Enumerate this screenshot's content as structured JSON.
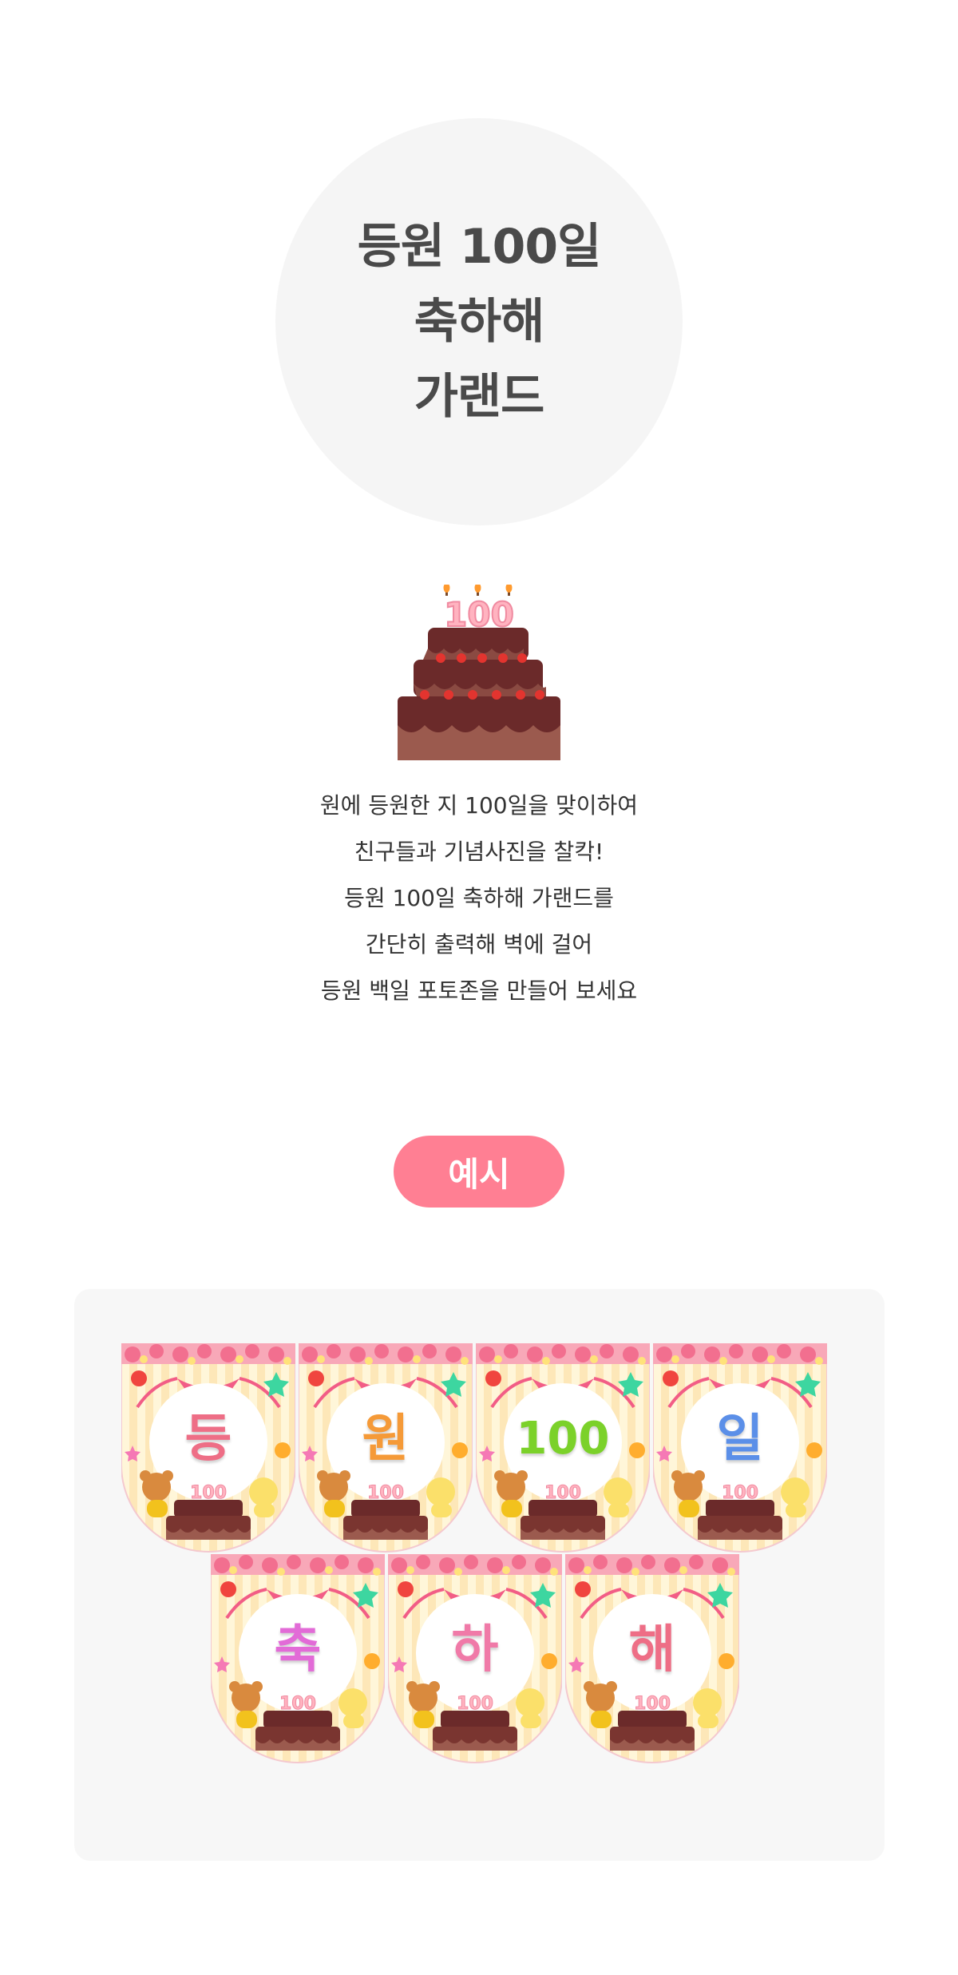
{
  "title": {
    "lines": [
      "등원 100일",
      "축하해",
      "가랜드"
    ]
  },
  "cake": {
    "topper_text": "100"
  },
  "description": {
    "lines": [
      "원에 등원한 지 100일을 맞이하여",
      "친구들과 기념사진을 찰칵!",
      "등원 100일 축하해 가랜드를",
      "간단히 출력해 벽에 걸어",
      "등원 백일 포토존을 만들어 보세요"
    ]
  },
  "example": {
    "label": "예시",
    "flags": [
      {
        "char": "등",
        "color": "#ee6e86"
      },
      {
        "char": "원",
        "color": "#f59a38"
      },
      {
        "char": "100",
        "color": "#7bd12a"
      },
      {
        "char": "일",
        "color": "#5b8fe8"
      },
      {
        "char": "축",
        "color": "#e26bd7"
      },
      {
        "char": "하",
        "color": "#f07aa8"
      },
      {
        "char": "해",
        "color": "#ee6e86"
      }
    ]
  },
  "colors": {
    "pill": "#ff7f93",
    "circle_bg": "#f5f5f5",
    "panel_bg": "#f7f7f7",
    "title_text": "#4a4a4a"
  }
}
